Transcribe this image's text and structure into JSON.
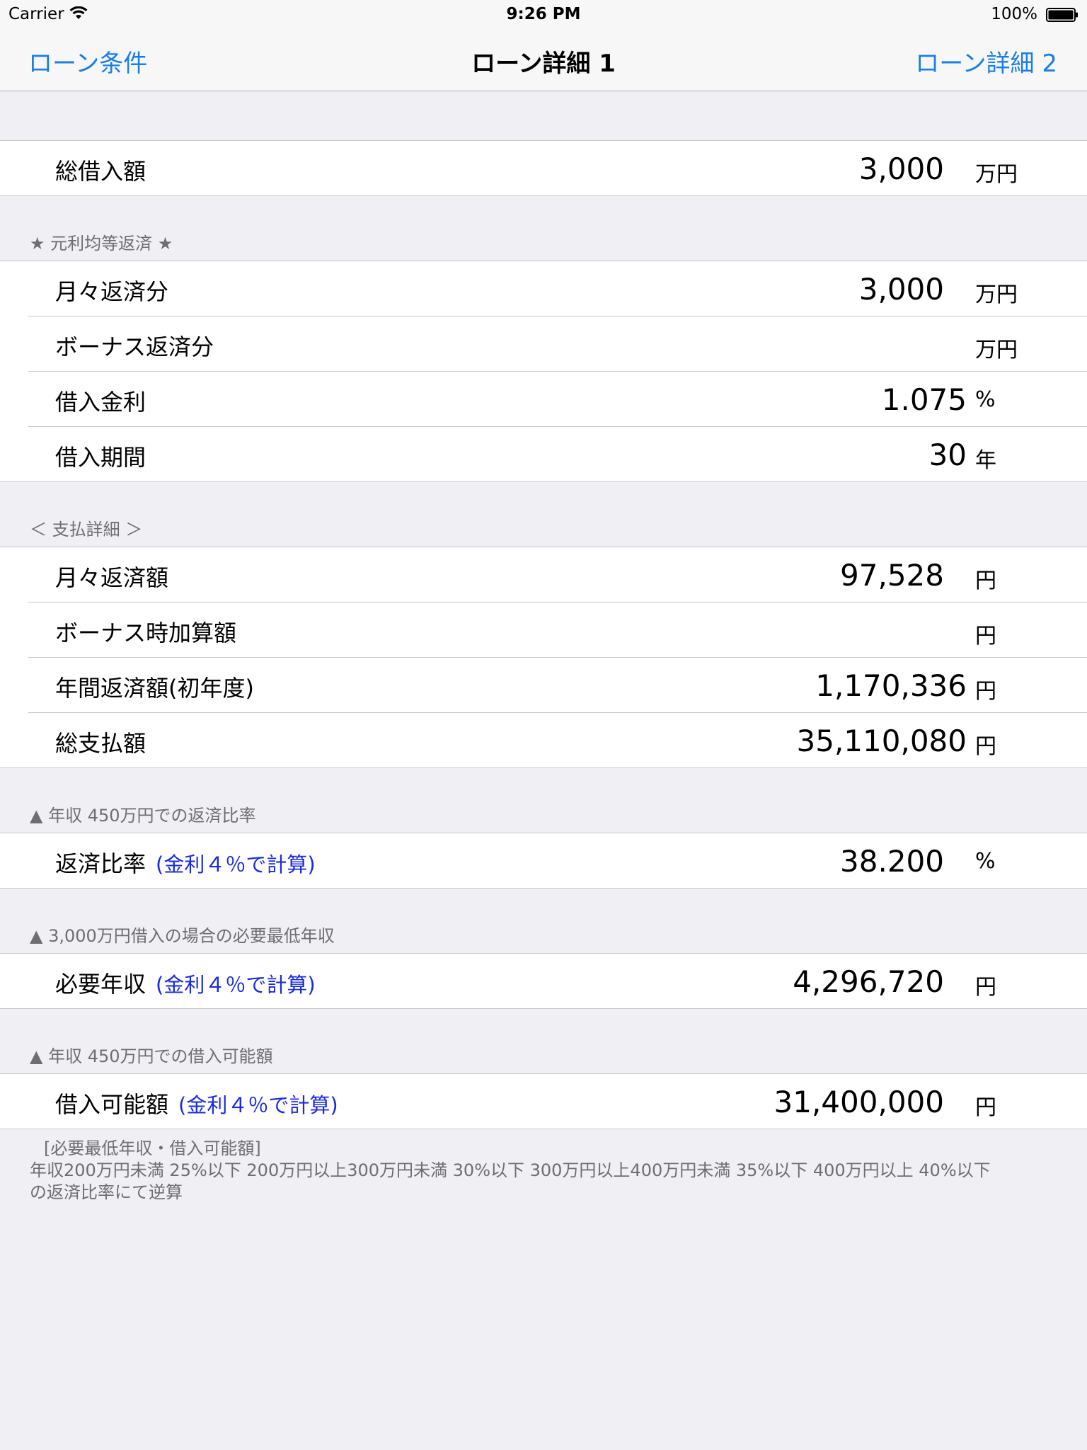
{
  "status_bar": {
    "carrier": "Carrier",
    "time": "9:26 PM",
    "battery": "100%"
  },
  "nav": {
    "left": "ローン条件",
    "title": "ローン詳細 1",
    "right": "ローン詳細 2"
  },
  "total": {
    "label": "総借入額",
    "value": "3,000",
    "unit": "万円"
  },
  "section_equal": {
    "header": "★ 元利均等返済 ★",
    "rows": [
      {
        "label": "月々返済分",
        "value": "3,000",
        "unit": "万円"
      },
      {
        "label": "ボーナス返済分",
        "value": "",
        "unit": "万円"
      },
      {
        "label": "借入金利",
        "value": "1.075",
        "unit": "%"
      },
      {
        "label": "借入期間",
        "value": "30",
        "unit": "年"
      }
    ]
  },
  "section_payment": {
    "header": "＜ 支払詳細 ＞",
    "rows": [
      {
        "label": "月々返済額",
        "value": "97,528",
        "unit": "円"
      },
      {
        "label": "ボーナス時加算額",
        "value": "",
        "unit": "円"
      },
      {
        "label": "年間返済額(初年度)",
        "value": "1,170,336",
        "unit": "円"
      },
      {
        "label": "総支払額",
        "value": "35,110,080",
        "unit": "円"
      }
    ]
  },
  "section_ratio": {
    "header": "▲ 年収 450万円での返済比率",
    "label": "返済比率",
    "sublabel": "(金利４％で計算)",
    "value": "38.200",
    "unit": "%"
  },
  "section_income": {
    "header": "▲ 3,000万円借入の場合の必要最低年収",
    "label": "必要年収",
    "sublabel": "(金利４％で計算)",
    "value": "4,296,720",
    "unit": "円"
  },
  "section_borrow": {
    "header": "▲ 年収 450万円での借入可能額",
    "label": "借入可能額",
    "sublabel": "(金利４％で計算)",
    "value": "31,400,000",
    "unit": "円"
  },
  "footer": {
    "title": "[必要最低年収・借入可能額]",
    "line1": "年収200万円未満 25%以下 200万円以上300万円未満 30%以下 300万円以上400万円未満 35%以下 400万円以上 40%以下",
    "line2": "の返済比率にて逆算"
  }
}
